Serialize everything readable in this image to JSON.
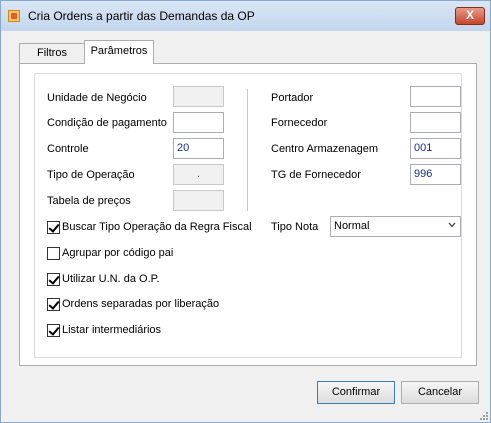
{
  "window": {
    "title": "Cria Ordens a partir das Demandas da OP",
    "close_label": "X"
  },
  "tabs": [
    {
      "label": "Filtros"
    },
    {
      "label": "Parâmetros"
    }
  ],
  "form": {
    "unidade_negocio": {
      "label": "Unidade de Negócio",
      "value": ""
    },
    "condicao_pagamento": {
      "label": "Condição de pagamento",
      "value": ""
    },
    "controle": {
      "label": "Controle",
      "value": "20"
    },
    "tipo_operacao": {
      "label": "Tipo de Operação",
      "value": "."
    },
    "tabela_precos": {
      "label": "Tabela de preços",
      "value": ""
    },
    "portador": {
      "label": "Portador",
      "value": ""
    },
    "fornecedor": {
      "label": "Fornecedor",
      "value": ""
    },
    "centro_armazenagem": {
      "label": "Centro Armazenagem",
      "value": "001"
    },
    "tg_fornecedor": {
      "label": "TG de Fornecedor",
      "value": "996"
    },
    "tipo_nota": {
      "label": "Tipo Nota",
      "value": "Normal"
    }
  },
  "checkboxes": [
    {
      "label": "Buscar Tipo Operação da Regra Fiscal",
      "checked": true
    },
    {
      "label": "Agrupar por código pai",
      "checked": false
    },
    {
      "label": "Utilizar U.N. da O.P.",
      "checked": true
    },
    {
      "label": "Ordens separadas por liberação",
      "checked": true
    },
    {
      "label": "Listar intermediários",
      "checked": true
    }
  ],
  "buttons": {
    "confirm": "Confirmar",
    "cancel": "Cancelar"
  }
}
